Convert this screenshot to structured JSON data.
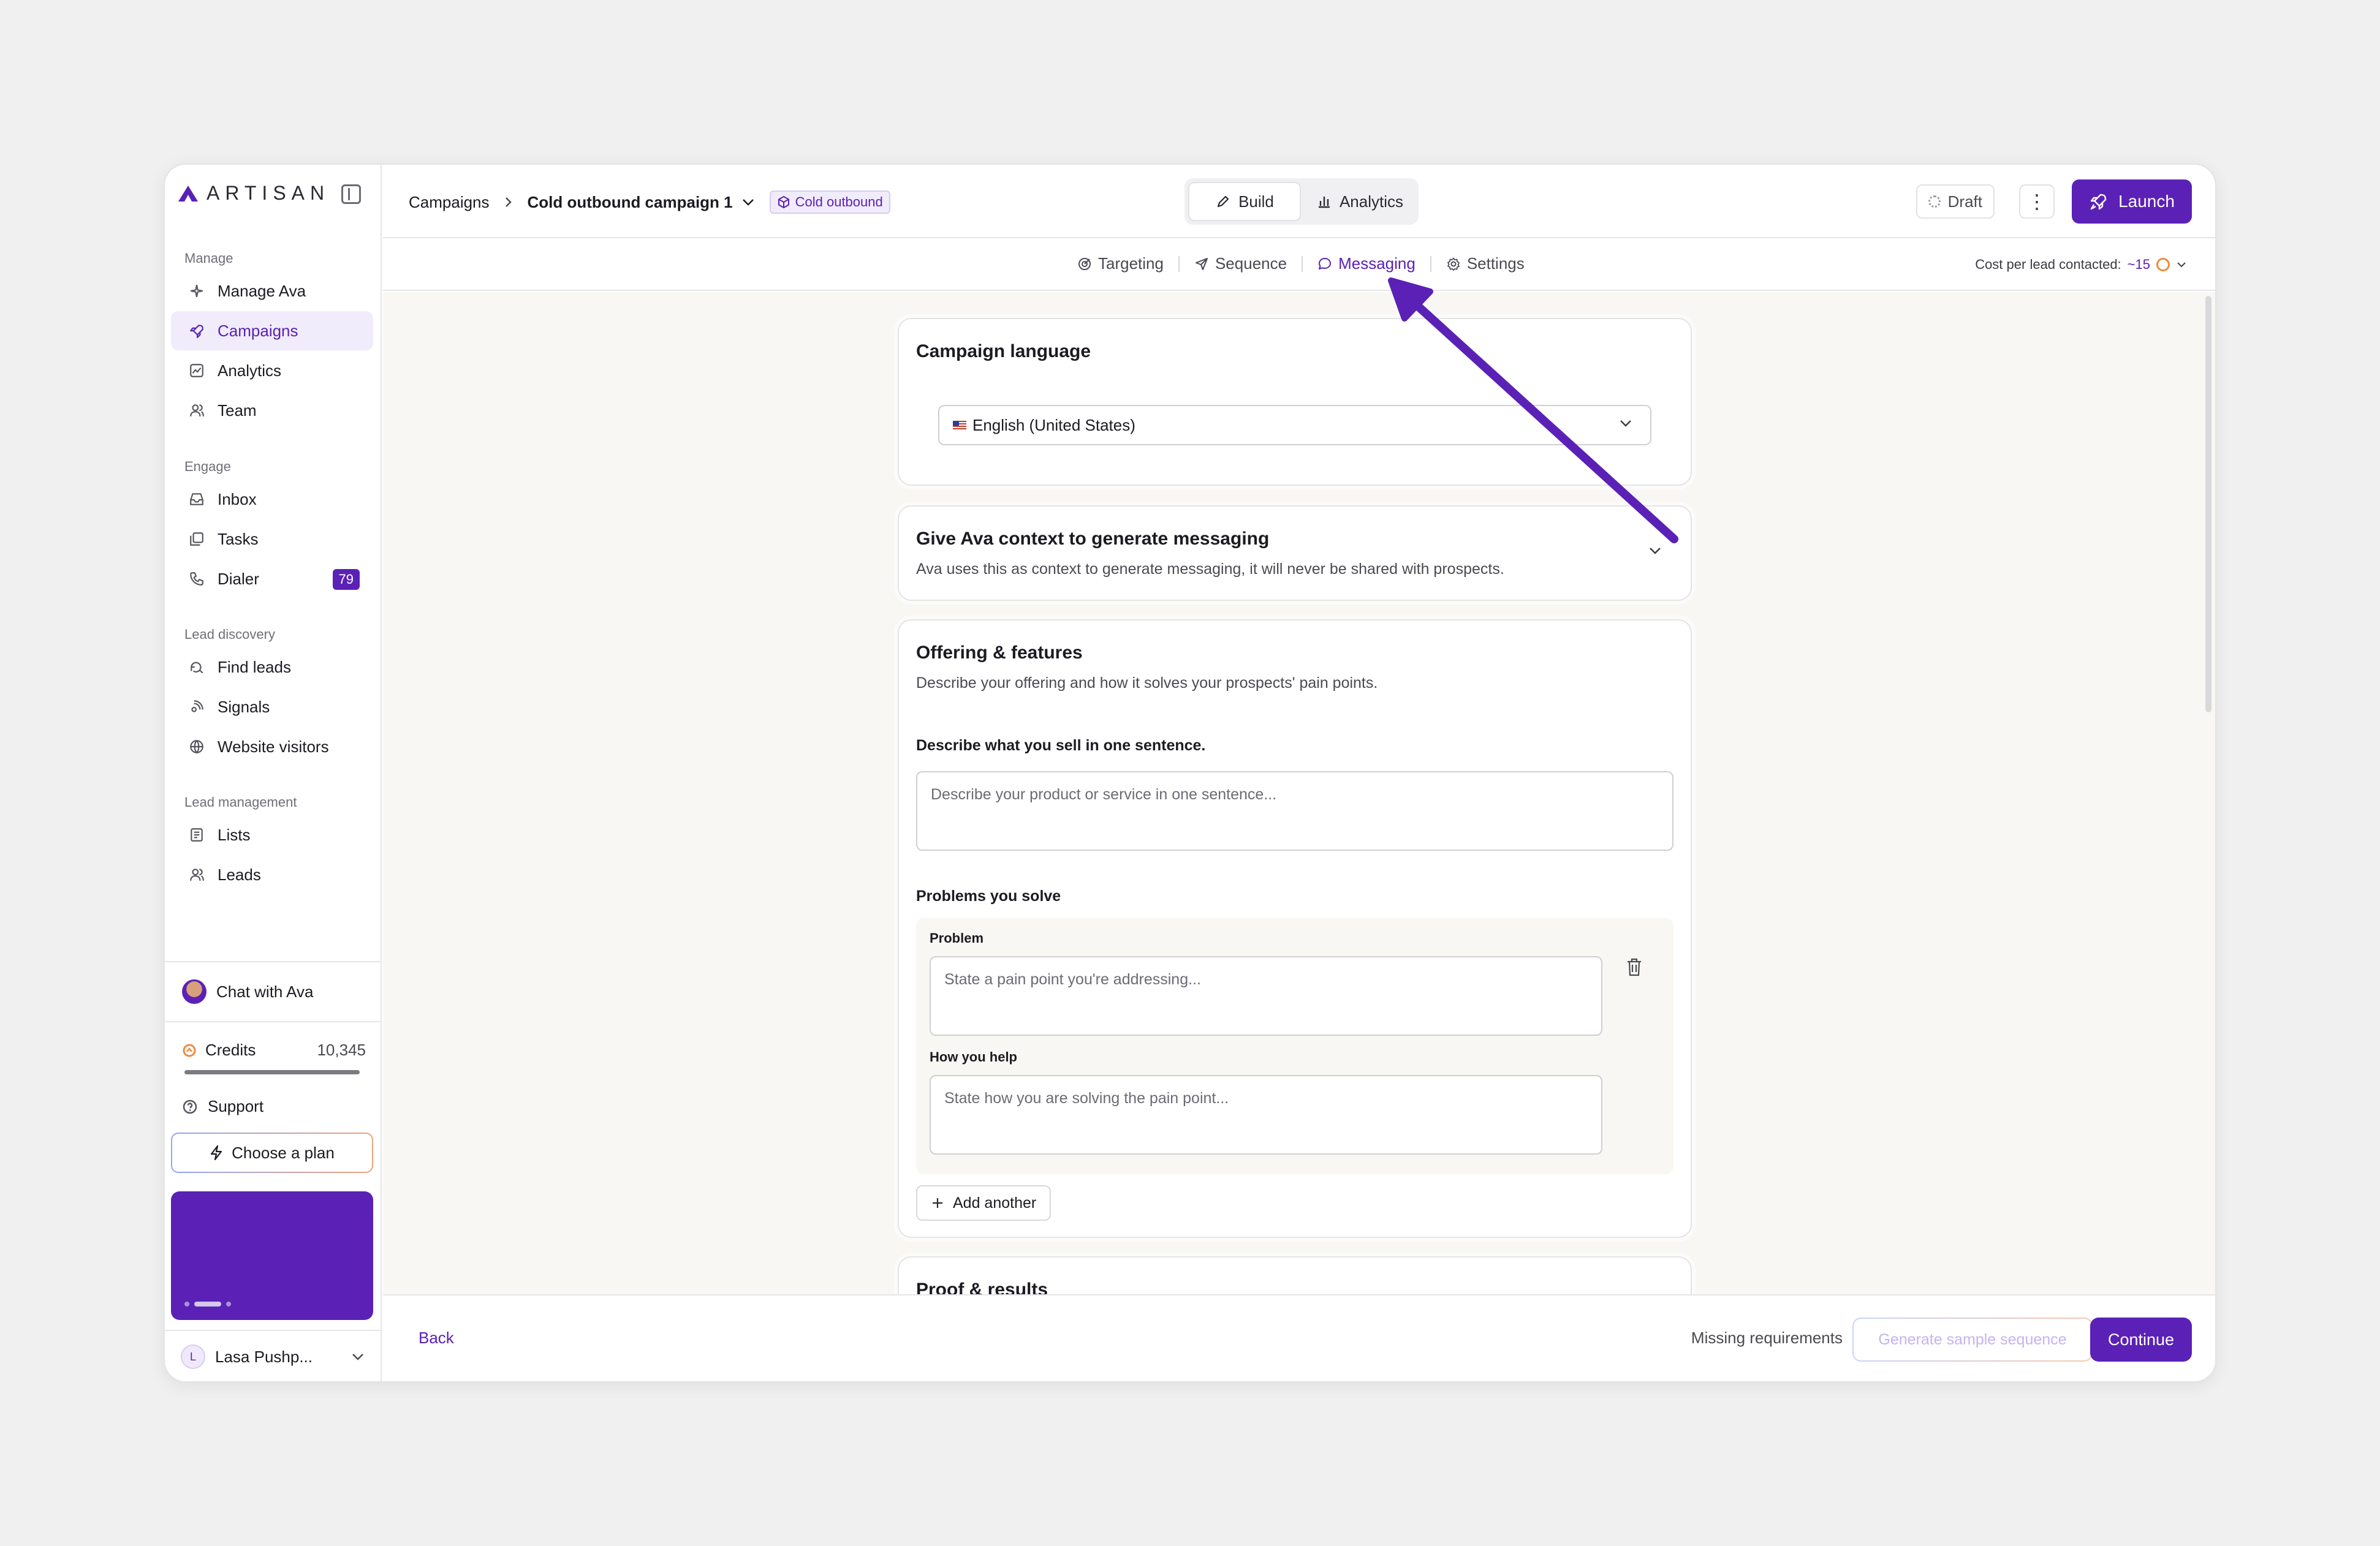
{
  "brand": {
    "name": "ARTISAN",
    "accent": "#5b21b6"
  },
  "sidebar": {
    "sections": [
      {
        "label": "Manage",
        "items": [
          {
            "label": "Manage Ava",
            "icon": "sparkle-icon"
          },
          {
            "label": "Campaigns",
            "icon": "rocket-icon",
            "active": true
          },
          {
            "label": "Analytics",
            "icon": "chart-icon"
          },
          {
            "label": "Team",
            "icon": "users-icon"
          }
        ]
      },
      {
        "label": "Engage",
        "items": [
          {
            "label": "Inbox",
            "icon": "inbox-icon"
          },
          {
            "label": "Tasks",
            "icon": "tasks-icon"
          },
          {
            "label": "Dialer",
            "icon": "phone-icon",
            "badge": "79"
          }
        ]
      },
      {
        "label": "Lead discovery",
        "items": [
          {
            "label": "Find leads",
            "icon": "search-icon"
          },
          {
            "label": "Signals",
            "icon": "signal-icon"
          },
          {
            "label": "Website visitors",
            "icon": "globe-icon"
          }
        ]
      },
      {
        "label": "Lead management",
        "items": [
          {
            "label": "Lists",
            "icon": "list-icon"
          },
          {
            "label": "Leads",
            "icon": "users-icon"
          }
        ]
      }
    ],
    "chat": "Chat with Ava",
    "credits": {
      "label": "Credits",
      "value": "10,345",
      "fill": 1.0
    },
    "support": "Support",
    "choose_plan": "Choose a plan",
    "user": {
      "initial": "L",
      "name": "Lasa Pushp..."
    }
  },
  "topbar": {
    "crumb_root": "Campaigns",
    "crumb_current": "Cold outbound campaign 1",
    "tag": "Cold outbound",
    "mode_build": "Build",
    "mode_analytics": "Analytics",
    "draft": "Draft",
    "more": "⋮",
    "launch": "Launch"
  },
  "subnav": {
    "tabs": [
      "Targeting",
      "Sequence",
      "Messaging",
      "Settings"
    ],
    "active_tab": "Messaging",
    "cost_label": "Cost per lead contacted:",
    "cost_value": "~15"
  },
  "cards": {
    "language": {
      "title": "Campaign language",
      "selected": "English (United States)"
    },
    "context": {
      "title": "Give Ava context to generate messaging",
      "desc": "Ava uses this as context to generate messaging, it will never be shared with prospects."
    },
    "offering": {
      "title": "Offering & features",
      "desc": "Describe your offering and how it solves your prospects' pain points.",
      "sell_label": "Describe what you sell in one sentence.",
      "sell_placeholder": "Describe your product or service in one sentence...",
      "problems_label": "Problems you solve",
      "problem_label": "Problem",
      "problem_placeholder": "State a pain point you're addressing...",
      "help_label": "How you help",
      "help_placeholder": "State how you are solving the pain point...",
      "add_another": "Add another"
    },
    "proof": {
      "title": "Proof & results"
    }
  },
  "footer": {
    "back": "Back",
    "missing": "Missing requirements",
    "generate": "Generate sample sequence",
    "continue": "Continue"
  }
}
